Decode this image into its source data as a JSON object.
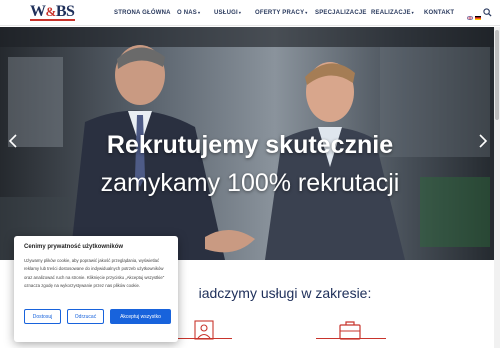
{
  "logo": {
    "text_w": "W",
    "text_amp": "&",
    "text_bs": "BS"
  },
  "nav": {
    "items": [
      {
        "label": "STRONA GŁÓWNA",
        "dropdown": false
      },
      {
        "label": "O NAS",
        "dropdown": true
      },
      {
        "label": "USŁUGI",
        "dropdown": true
      },
      {
        "label": "OFERTY PRACY",
        "dropdown": true
      },
      {
        "label": "SPECJALIZACJE",
        "dropdown": false
      },
      {
        "label": "REALIZACJE",
        "dropdown": true
      },
      {
        "label": "KONTAKT",
        "dropdown": false
      }
    ],
    "caret": "▾",
    "languages": [
      "english-flag-icon",
      "german-flag-icon"
    ],
    "search_icon": "search-icon"
  },
  "hero": {
    "title_line1": "Rekrutujemy skutecznie",
    "title_line2": "zamykamy 100% rekrutacji",
    "prev_icon": "chevron-left-icon",
    "next_icon": "chevron-right-icon"
  },
  "services": {
    "title": "iadczymy usługi w zakresie:",
    "icons": [
      "recruitment-icon",
      "candidate-icon",
      "briefcase-icon"
    ]
  },
  "cookie": {
    "title": "Cenimy prywatność użytkowników",
    "text": "Używamy plików cookie, aby poprawić jakość przeglądania, wyświetlać reklamy lub treści dostosowane do indywidualnych potrzeb użytkowników oraz analizować ruch na stronie. Kliknięcie przycisku „Akceptuj wszystkie\" oznacza zgodę na wykorzystywanie przez nas plików cookie.",
    "btn_customize": "Dostosuj",
    "btn_reject": "Odrzucać",
    "btn_accept": "Akceptuj wszystko"
  },
  "colors": {
    "brand_navy": "#1e2f5a",
    "brand_red": "#c8342c",
    "cookie_blue": "#1863dc"
  }
}
